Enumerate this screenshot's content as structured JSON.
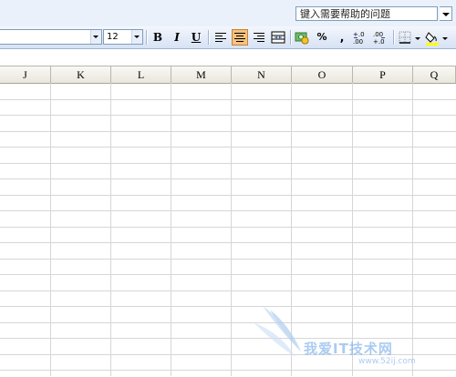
{
  "help_box": {
    "placeholder": "键入需要帮助的问题"
  },
  "toolbar": {
    "font_size": "12",
    "bold_label": "B",
    "italic_label": "I",
    "underline_label": "U",
    "percent_label": "%",
    "comma_label": ",",
    "increase_decimal_label": "+.0\n.00",
    "decrease_decimal_label": ".00\n+.0"
  },
  "columns": [
    "J",
    "K",
    "L",
    "M",
    "N",
    "O",
    "P",
    "Q"
  ],
  "watermark": {
    "text": "我爱IT技术网",
    "url": "www.52ij.com"
  },
  "colors": {
    "active_button": "#f7c27f",
    "toolbar_bg": "#d6e2f5",
    "header_bg": "#e9e7dc",
    "gridline": "#d6d6d6"
  }
}
